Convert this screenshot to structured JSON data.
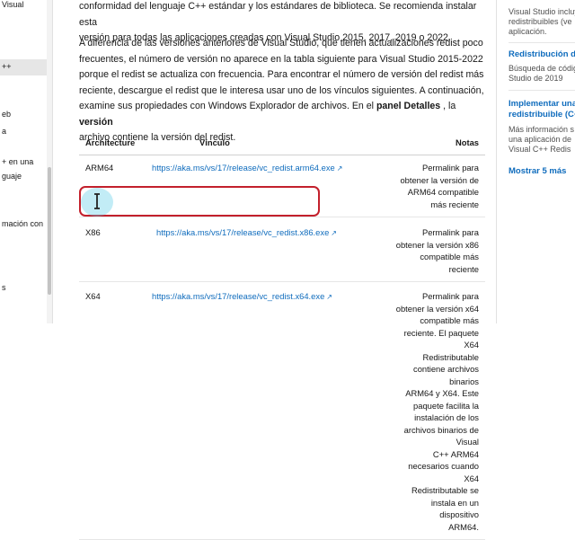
{
  "sidebar": {
    "items": [
      {
        "label": "Visual"
      },
      {
        "label": "++"
      },
      {
        "label": "eb"
      },
      {
        "label": "a"
      },
      {
        "label": "+ en una"
      },
      {
        "label": "guaje"
      },
      {
        "label": "mación con"
      },
      {
        "label": "s"
      }
    ]
  },
  "article": {
    "para1": {
      "line1": "conformidad del lenguaje C++ estándar y los estándares de biblioteca. Se recomienda instalar esta",
      "line2": "versión para todas las aplicaciones creadas con Visual Studio 2015, 2017, 2019 o 2022."
    },
    "para2": {
      "line1": "A diferencia de las versiones anteriores de Visual Studio, que tienen actualizaciones redist poco",
      "line2": "frecuentes, el número de versión no aparece en la tabla siguiente para Visual Studio 2015-2022",
      "line3": "porque el redist se actualiza con frecuencia. Para encontrar el número de versión del redist más",
      "line4": "reciente, descargue el redist que le interesa usar uno de los vínculos siguientes. A continuación,",
      "line5_pre": "examine sus propiedades con Windows Explorador de archivos. En el ",
      "line5_bold1": "panel Detalles",
      "line5_mid": " , la ",
      "line5_bold2": "versión",
      "line6": "archivo contiene la versión del redist."
    }
  },
  "table": {
    "headers": {
      "architecture": "Architecture",
      "link": "Vínculo",
      "notes": "Notas"
    },
    "rows": [
      {
        "arch": "ARM64",
        "url": "https://aka.ms/vs/17/release/vc_redist.arm64.exe",
        "note_lines": [
          "Permalink para obtener la versión de",
          "ARM64 compatible más reciente"
        ]
      },
      {
        "arch": "X86",
        "url": "https://aka.ms/vs/17/release/vc_redist.x86.exe",
        "note_lines": [
          "Permalink para obtener la versión x86",
          "compatible más reciente"
        ]
      },
      {
        "arch": "X64",
        "url": "https://aka.ms/vs/17/release/vc_redist.x64.exe",
        "note_lines": [
          "Permalink para obtener la versión x64",
          "compatible más reciente. El paquete X64",
          "Redistributable contiene archivos binarios",
          "ARM64 y X64. Este paquete facilita la",
          "instalación de los archivos binarios de Visual",
          "C++ ARM64 necesarios cuando X64",
          "Redistributable se instala en un dispositivo",
          "ARM64."
        ]
      }
    ]
  },
  "rightrail": {
    "top_lines": [
      "Visual Studio incluy",
      "redistribuibles (ve",
      "aplicación."
    ],
    "card1": {
      "title": "Redistribución de",
      "lines": [
        "Búsqueda de códig",
        "Studio de 2019"
      ]
    },
    "card2": {
      "title_lines": [
        "Implementar una",
        "redistribuible (C+"
      ],
      "lines": [
        "Más información s",
        "una aplicación de",
        "Visual C++ Redis"
      ]
    },
    "more_link": "Mostrar 5 más"
  },
  "colors": {
    "link": "#0f6cbd",
    "highlight_border": "#c3202c",
    "cursor_halo": "#50c8e6"
  }
}
